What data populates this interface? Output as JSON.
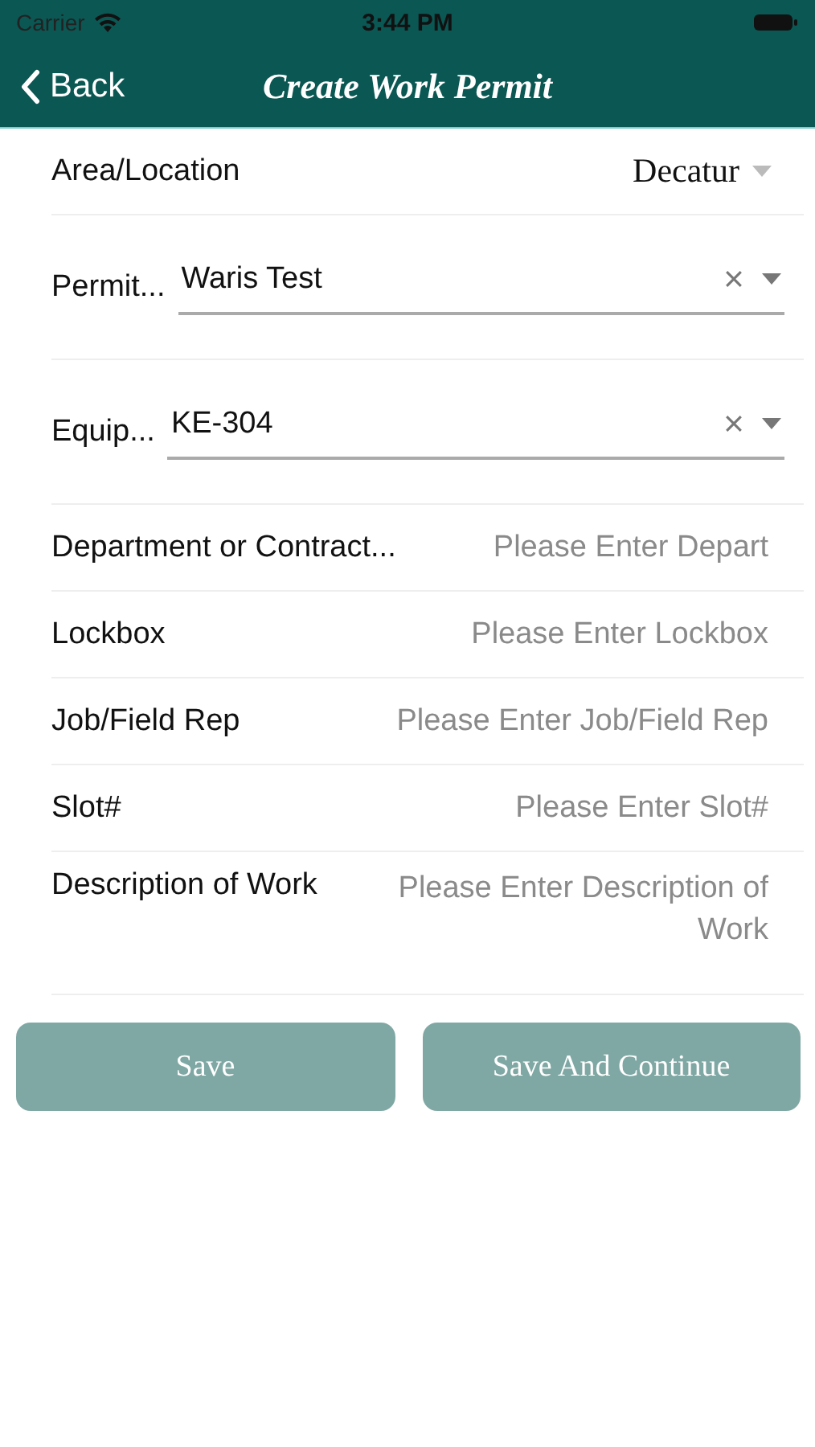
{
  "status_bar": {
    "carrier": "Carrier",
    "time": "3:44 PM"
  },
  "nav": {
    "back": "Back",
    "title": "Create Work Permit"
  },
  "fields": [
    {
      "kind": "picker",
      "label": "Area/Location",
      "value": "Decatur"
    },
    {
      "kind": "select",
      "label": "Permit...",
      "value": "Waris Test"
    },
    {
      "kind": "select",
      "label": "Equip...",
      "value": "KE-304"
    },
    {
      "kind": "text",
      "label": "Department or Contract...",
      "placeholder": "Please Enter Depart"
    },
    {
      "kind": "text",
      "label": "Lockbox",
      "placeholder": "Please Enter Lockbox"
    },
    {
      "kind": "text",
      "label": "Job/Field Rep",
      "placeholder": "Please Enter Job/Field Rep"
    },
    {
      "kind": "text",
      "label": "Slot#",
      "placeholder": "Please Enter Slot#"
    },
    {
      "kind": "textarea",
      "label": "Description of Work",
      "placeholder": "Please Enter Description of Work"
    }
  ],
  "buttons": [
    "Save",
    "Save And Continue"
  ]
}
